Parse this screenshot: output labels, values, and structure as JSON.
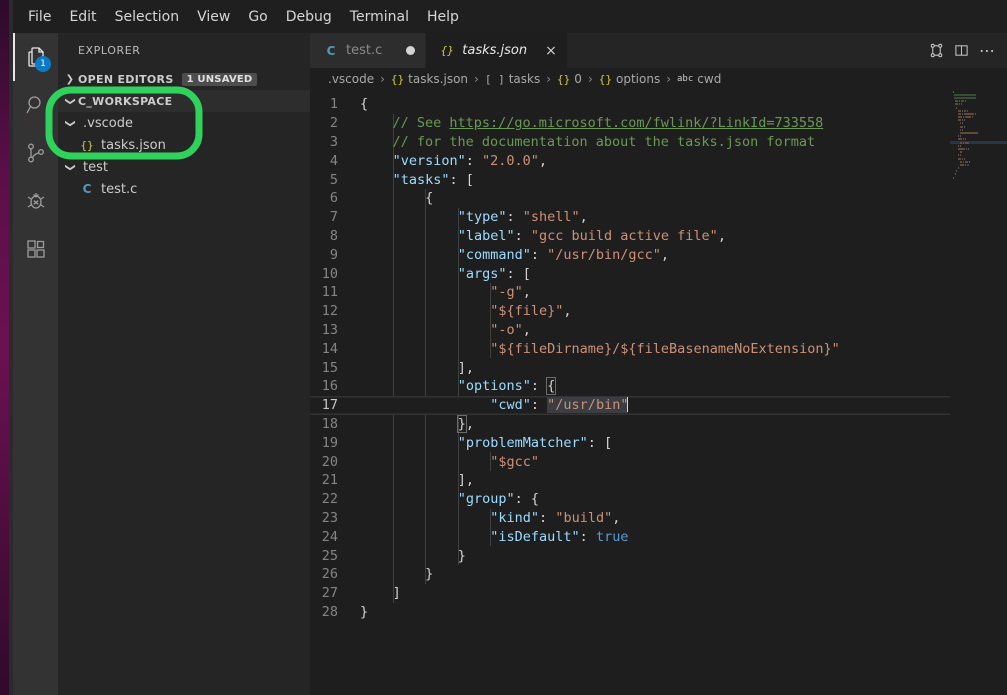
{
  "menubar": {
    "items": [
      "File",
      "Edit",
      "Selection",
      "View",
      "Go",
      "Debug",
      "Terminal",
      "Help"
    ]
  },
  "activitybar": {
    "items": [
      {
        "name": "explorer",
        "icon": "files-icon",
        "badge": "1",
        "active": true
      },
      {
        "name": "search",
        "icon": "search-icon",
        "badge": "",
        "active": false
      },
      {
        "name": "source-control",
        "icon": "source-control-icon",
        "badge": "",
        "active": false
      },
      {
        "name": "debug",
        "icon": "debug-icon",
        "badge": "",
        "active": false
      },
      {
        "name": "extensions",
        "icon": "extensions-icon",
        "badge": "",
        "active": false
      }
    ]
  },
  "sidebar": {
    "title": "EXPLORER",
    "open_editors": {
      "label": "OPEN EDITORS",
      "badge": "1 UNSAVED",
      "expanded": false
    },
    "workspace": {
      "label": "C_WORKSPACE",
      "expanded": true
    },
    "tree": [
      {
        "label": ".vscode",
        "type": "folder",
        "depth": 1,
        "expanded": true,
        "icon": "chevron-down-icon"
      },
      {
        "label": "tasks.json",
        "type": "json-file",
        "depth": 2,
        "icon": "json-icon"
      },
      {
        "label": "test",
        "type": "folder",
        "depth": 1,
        "expanded": true,
        "icon": "chevron-down-icon"
      },
      {
        "label": "test.c",
        "type": "c-file",
        "depth": 2,
        "icon": "c-icon"
      }
    ]
  },
  "annotation": {
    "shape": "rounded-rectangle",
    "color": "#2fd25a",
    "target": "workspace-vscode-tasks-json"
  },
  "editor": {
    "tabs": [
      {
        "label": "test.c",
        "icon": "c-icon",
        "active": false,
        "dirty": true,
        "close": ""
      },
      {
        "label": "tasks.json",
        "icon": "json-icon",
        "active": true,
        "dirty": false,
        "close": "×"
      }
    ],
    "actions": [
      {
        "name": "run-task-icon",
        "label": ""
      },
      {
        "name": "split-editor-icon",
        "label": ""
      },
      {
        "name": "more-actions-icon",
        "label": "⋯"
      }
    ],
    "breadcrumbs": [
      {
        "icon": "",
        "label": ".vscode"
      },
      {
        "icon": "{}",
        "label": "tasks.json"
      },
      {
        "icon": "[ ]",
        "label": "tasks"
      },
      {
        "icon": "{}",
        "label": "0"
      },
      {
        "icon": "{}",
        "label": "options"
      },
      {
        "icon": "abc",
        "label": "cwd"
      }
    ],
    "separator": "›",
    "cursor_line": 17,
    "selection_text": "\"/usr/bin\"",
    "lines": [
      {
        "n": 1,
        "text": "{"
      },
      {
        "n": 2,
        "text": "    // See https://go.microsoft.com/fwlink/?LinkId=733558"
      },
      {
        "n": 3,
        "text": "    // for the documentation about the tasks.json format"
      },
      {
        "n": 4,
        "text": "    \"version\": \"2.0.0\","
      },
      {
        "n": 5,
        "text": "    \"tasks\": ["
      },
      {
        "n": 6,
        "text": "        {"
      },
      {
        "n": 7,
        "text": "            \"type\": \"shell\","
      },
      {
        "n": 8,
        "text": "            \"label\": \"gcc build active file\","
      },
      {
        "n": 9,
        "text": "            \"command\": \"/usr/bin/gcc\","
      },
      {
        "n": 10,
        "text": "            \"args\": ["
      },
      {
        "n": 11,
        "text": "                \"-g\","
      },
      {
        "n": 12,
        "text": "                \"${file}\","
      },
      {
        "n": 13,
        "text": "                \"-o\","
      },
      {
        "n": 14,
        "text": "                \"${fileDirname}/${fileBasenameNoExtension}\""
      },
      {
        "n": 15,
        "text": "            ],"
      },
      {
        "n": 16,
        "text": "            \"options\": {"
      },
      {
        "n": 17,
        "text": "                \"cwd\": \"/usr/bin\""
      },
      {
        "n": 18,
        "text": "            },"
      },
      {
        "n": 19,
        "text": "            \"problemMatcher\": ["
      },
      {
        "n": 20,
        "text": "                \"$gcc\""
      },
      {
        "n": 21,
        "text": "            ],"
      },
      {
        "n": 22,
        "text": "            \"group\": {"
      },
      {
        "n": 23,
        "text": "                \"kind\": \"build\","
      },
      {
        "n": 24,
        "text": "                \"isDefault\": true"
      },
      {
        "n": 25,
        "text": "            }"
      },
      {
        "n": 26,
        "text": "        }"
      },
      {
        "n": 27,
        "text": "    ]"
      },
      {
        "n": 28,
        "text": "}"
      }
    ]
  },
  "colors": {
    "editor_bg": "#1e1e1e",
    "sidebar_bg": "#252526",
    "activitybar_bg": "#333333",
    "accent_badge": "#0d7ac8",
    "annotation_green": "#2fd25a",
    "string": "#ce9178",
    "key": "#9cdcfe",
    "comment": "#6a9955",
    "boolean": "#569cd6"
  }
}
